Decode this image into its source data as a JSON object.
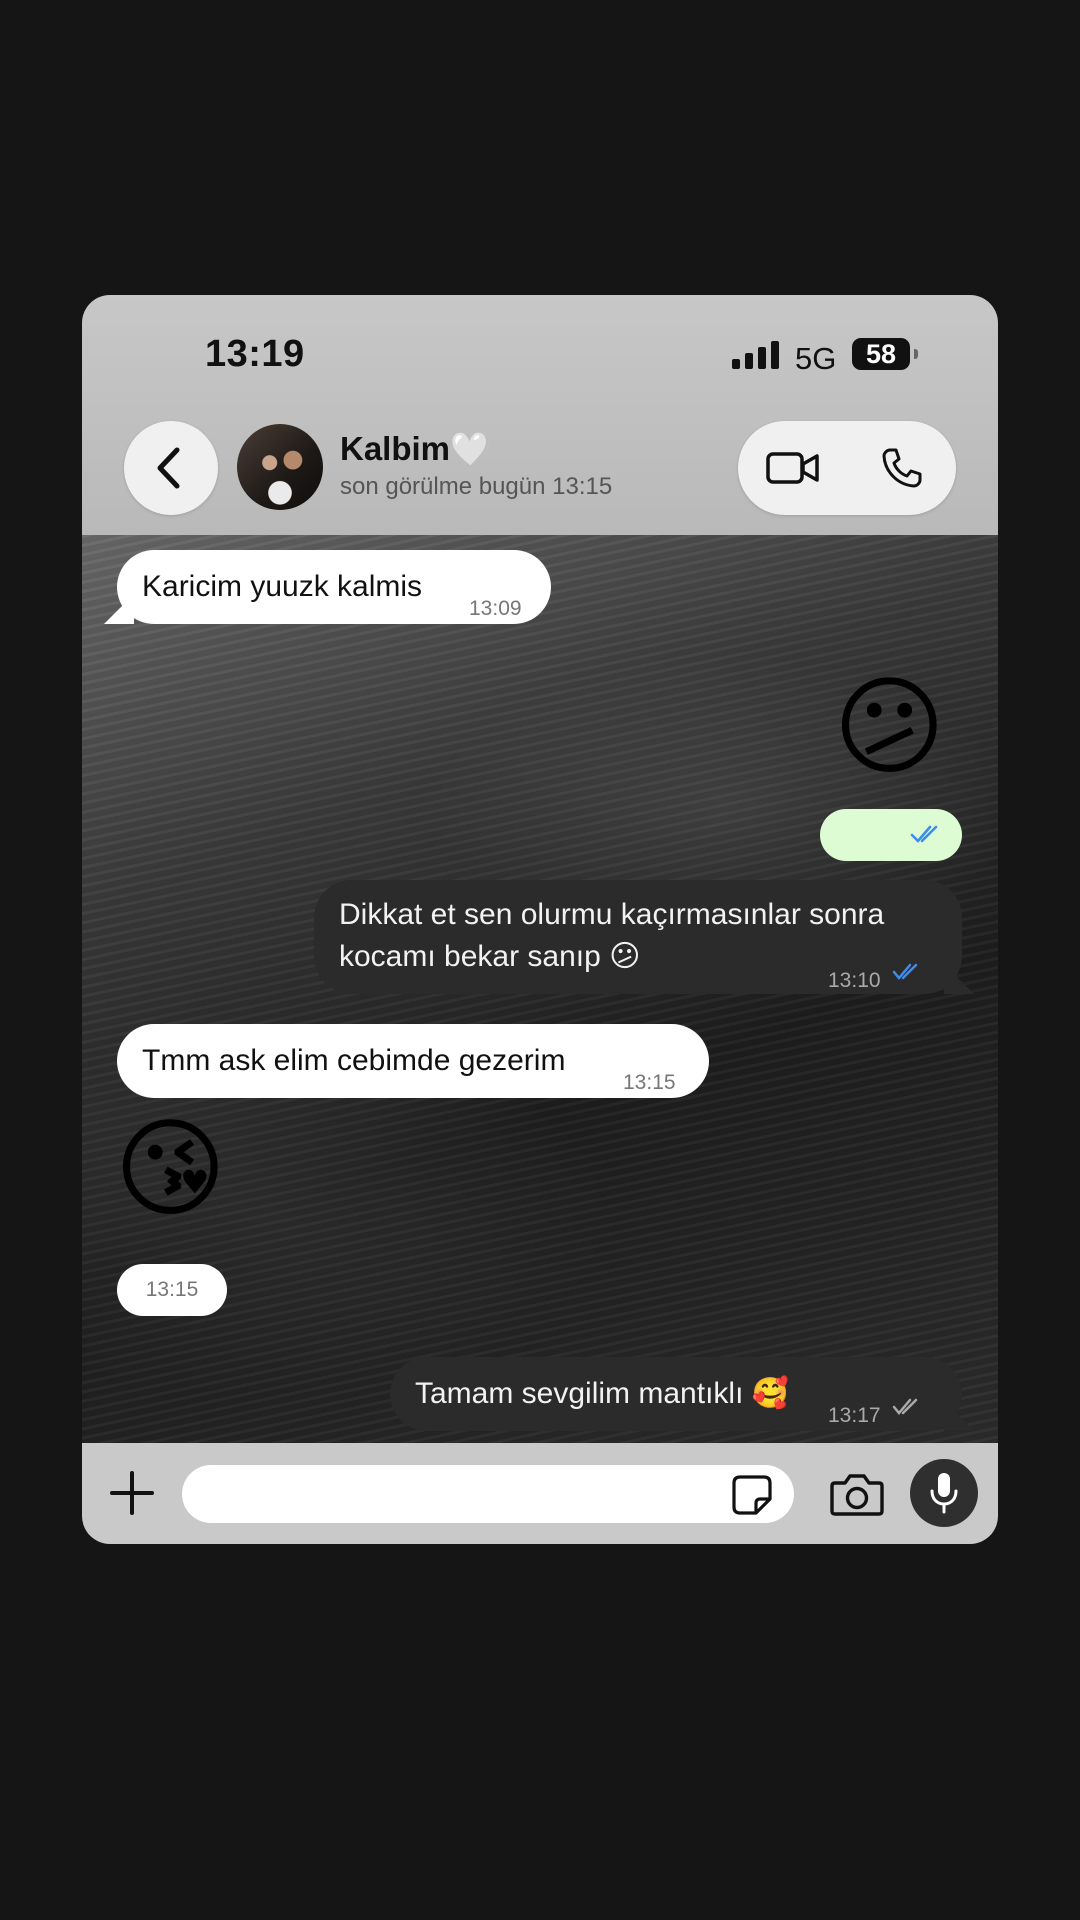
{
  "status_bar": {
    "time": "13:19",
    "network": "5G",
    "battery": "58"
  },
  "header": {
    "contact_name": "Kalbim🤍",
    "last_seen": "son görülme bugün 13:15"
  },
  "icons": {
    "back": "chevron-left-icon",
    "video": "video-camera-icon",
    "call": "phone-icon",
    "attach": "plus-icon",
    "sticker": "sticker-icon",
    "camera": "camera-icon",
    "mic": "microphone-icon"
  },
  "colors": {
    "incoming_bubble": "#ffffff",
    "outgoing_bubble": "#2b2b2b",
    "read_tick": "#3d8cf0",
    "outgoing_time_pill": "#ddfcd3"
  },
  "messages": [
    {
      "direction": "in",
      "text": "Karicim yuuzk kalmis",
      "time": "13:09"
    },
    {
      "direction": "out",
      "emoji": "😕",
      "time": "",
      "status": "read"
    },
    {
      "direction": "out",
      "text_line1": "Dikkat et sen olurmu kaçırmasınlar sonra",
      "text_line2": "kocamı bekar sanıp 😕",
      "time": "13:10",
      "status": "read"
    },
    {
      "direction": "in",
      "text": "Tmm ask elim cebimde gezerim",
      "time": "13:15"
    },
    {
      "direction": "in",
      "emoji": "😘",
      "time": "13:15"
    },
    {
      "direction": "out",
      "text": "Tamam sevgilim mantıklı 🥰",
      "time": "13:17",
      "status": "delivered"
    }
  ],
  "composer": {
    "value": "",
    "placeholder": ""
  }
}
